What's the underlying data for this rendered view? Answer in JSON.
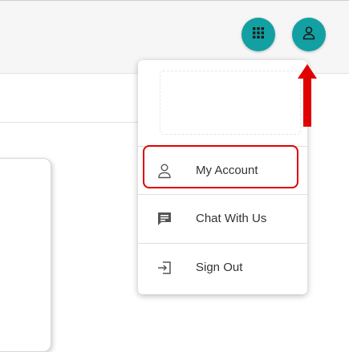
{
  "header": {
    "apps_icon": "grid-icon",
    "profile_icon": "user-icon",
    "accent_color": "#12a0a3"
  },
  "menu": {
    "items": [
      {
        "label": "My Account",
        "icon": "user-outline-icon"
      },
      {
        "label": "Chat With Us",
        "icon": "chat-icon"
      },
      {
        "label": "Sign Out",
        "icon": "sign-out-icon"
      }
    ]
  },
  "annotation": {
    "highlight_color": "#e10000"
  }
}
